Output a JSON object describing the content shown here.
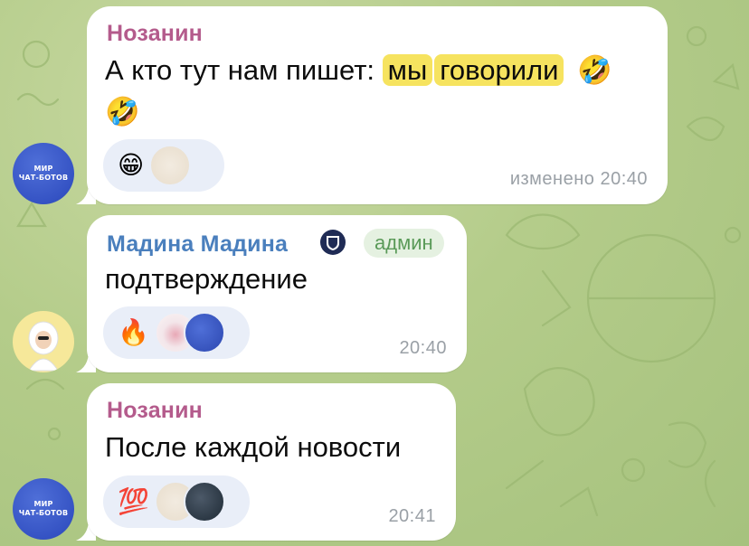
{
  "messages": [
    {
      "sender": "Нозанин",
      "sender_color": "#b45b8c",
      "text_before": "А кто тут нам пишет: ",
      "highlight_1": "мы",
      "highlight_2": "говорили",
      "emoji_inline": "🤣",
      "emoji_line2": "🤣",
      "reaction_emoji": "😁",
      "time": "изменено 20:40",
      "avatar_line1": "МИР",
      "avatar_line2": "ЧАТ-БОТОВ"
    },
    {
      "sender": "Мадина Мадина",
      "sender_color": "#4a7fbd",
      "badge": "админ",
      "text": "подтверждение",
      "reaction_emoji": "🔥",
      "time": "20:40"
    },
    {
      "sender": "Нозанин",
      "sender_color": "#b45b8c",
      "text": "После каждой новости",
      "reaction_emoji": "💯",
      "time": "20:41",
      "avatar_line1": "МИР",
      "avatar_line2": "ЧАТ-БОТОВ"
    }
  ],
  "colors": {
    "highlight": "#f6e35f",
    "bubble": "#ffffff",
    "reaction_bg": "#e9eef8",
    "admin_badge_text": "#5a9a58"
  }
}
